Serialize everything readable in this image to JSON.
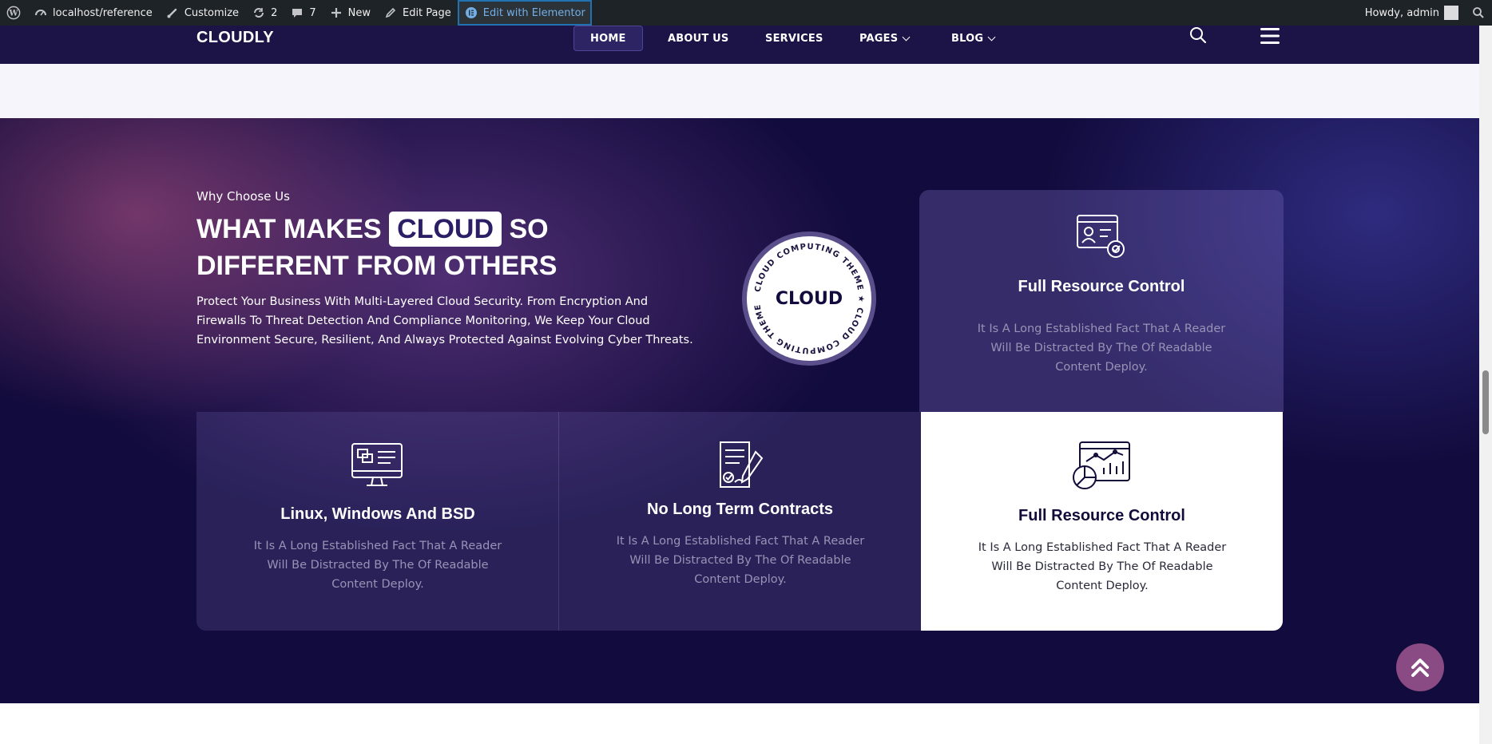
{
  "admin_bar": {
    "site": "localhost/reference",
    "customize": "Customize",
    "updates": "2",
    "comments": "7",
    "new": "New",
    "edit_page": "Edit Page",
    "elementor": "Edit with Elementor",
    "howdy": "Howdy, admin"
  },
  "header": {
    "logo": "CLOUDLY",
    "nav": [
      "HOME",
      "ABOUT US",
      "SERVICES",
      "PAGES",
      "BLOG"
    ]
  },
  "section": {
    "eyebrow": "Why Choose Us",
    "headline_pre": "WHAT MAKES",
    "headline_highlight": "CLOUD",
    "headline_post": "SO DIFFERENT FROM OTHERS",
    "intro": "Protect Your Business With Multi-Layered Cloud Security. From Encryption And Firewalls To Threat Detection And Compliance Monitoring, We Keep Your Cloud Environment Secure, Resilient, And Always Protected Against Evolving Cyber Threats."
  },
  "badge": {
    "center": "CLOUD",
    "ring": "CLOUD COMPUTING THEME ★ CLOUD COMPUTING THEME ★"
  },
  "cards": [
    {
      "title": "Full Resource Control",
      "desc": "It Is A Long Established Fact That A Reader Will Be Distracted By The Of Readable Content Deploy.",
      "icon": "settings-panel-icon"
    },
    {
      "title": "Linux, Windows And BSD",
      "desc": "It Is A Long Established Fact That A Reader Will Be Distracted By The Of Readable Content Deploy.",
      "icon": "monitor-icon"
    },
    {
      "title": "No Long Term Contracts",
      "desc": "It Is A Long Established Fact That A Reader Will Be Distracted By The Of Readable Content Deploy.",
      "icon": "contract-icon"
    },
    {
      "title": "Full Resource Control",
      "desc": "It Is A Long Established Fact That A Reader Will Be Distracted By The Of Readable Content Deploy.",
      "icon": "analytics-icon"
    }
  ],
  "colors": {
    "section_bg": "#120b3d",
    "header_bg": "#1c1347",
    "accent": "#8a4a84",
    "admin_bar": "#1d2327"
  }
}
